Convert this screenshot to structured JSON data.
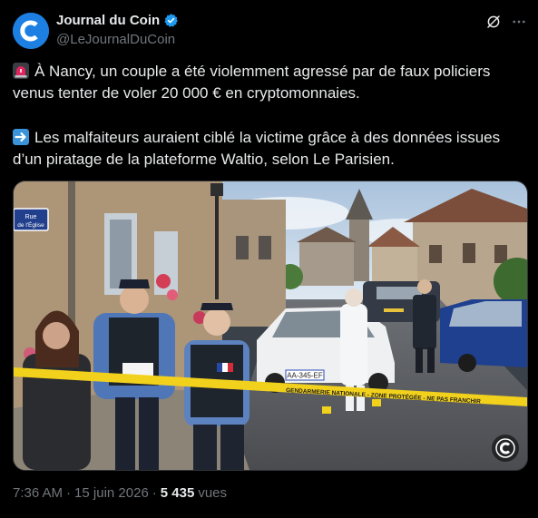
{
  "account": {
    "display_name": "Journal du Coin",
    "handle": "@LeJournalDuCoin",
    "verified": true,
    "brand_color": "#1d7fe2"
  },
  "tweet": {
    "line1": "À Nancy, un couple a été violemment agressé par de faux policiers venus tenter de voler 20 000 € en cryptomonnaies.",
    "line2": "Les malfaiteurs auraient ciblé la victime grâce à des données issues d’un piratage de la plateforme Waltio, selon Le Parisien.",
    "emoji1": "police-siren-icon",
    "emoji2": "right-arrow-icon"
  },
  "media": {
    "street_sign_line1": "Rue",
    "street_sign_line2": "de l'Église",
    "license_plate": "AA-345-EF",
    "tape_text": "GENDARMERIE NATIONALE - ZONE PROTÉGÉE - NE PAS FRANCHIR",
    "police_badge": "POLICE"
  },
  "footer": {
    "time": "7:36 AM",
    "separator": "·",
    "date": "15 juin 2026",
    "views_count": "5 435",
    "views_label": "vues"
  }
}
